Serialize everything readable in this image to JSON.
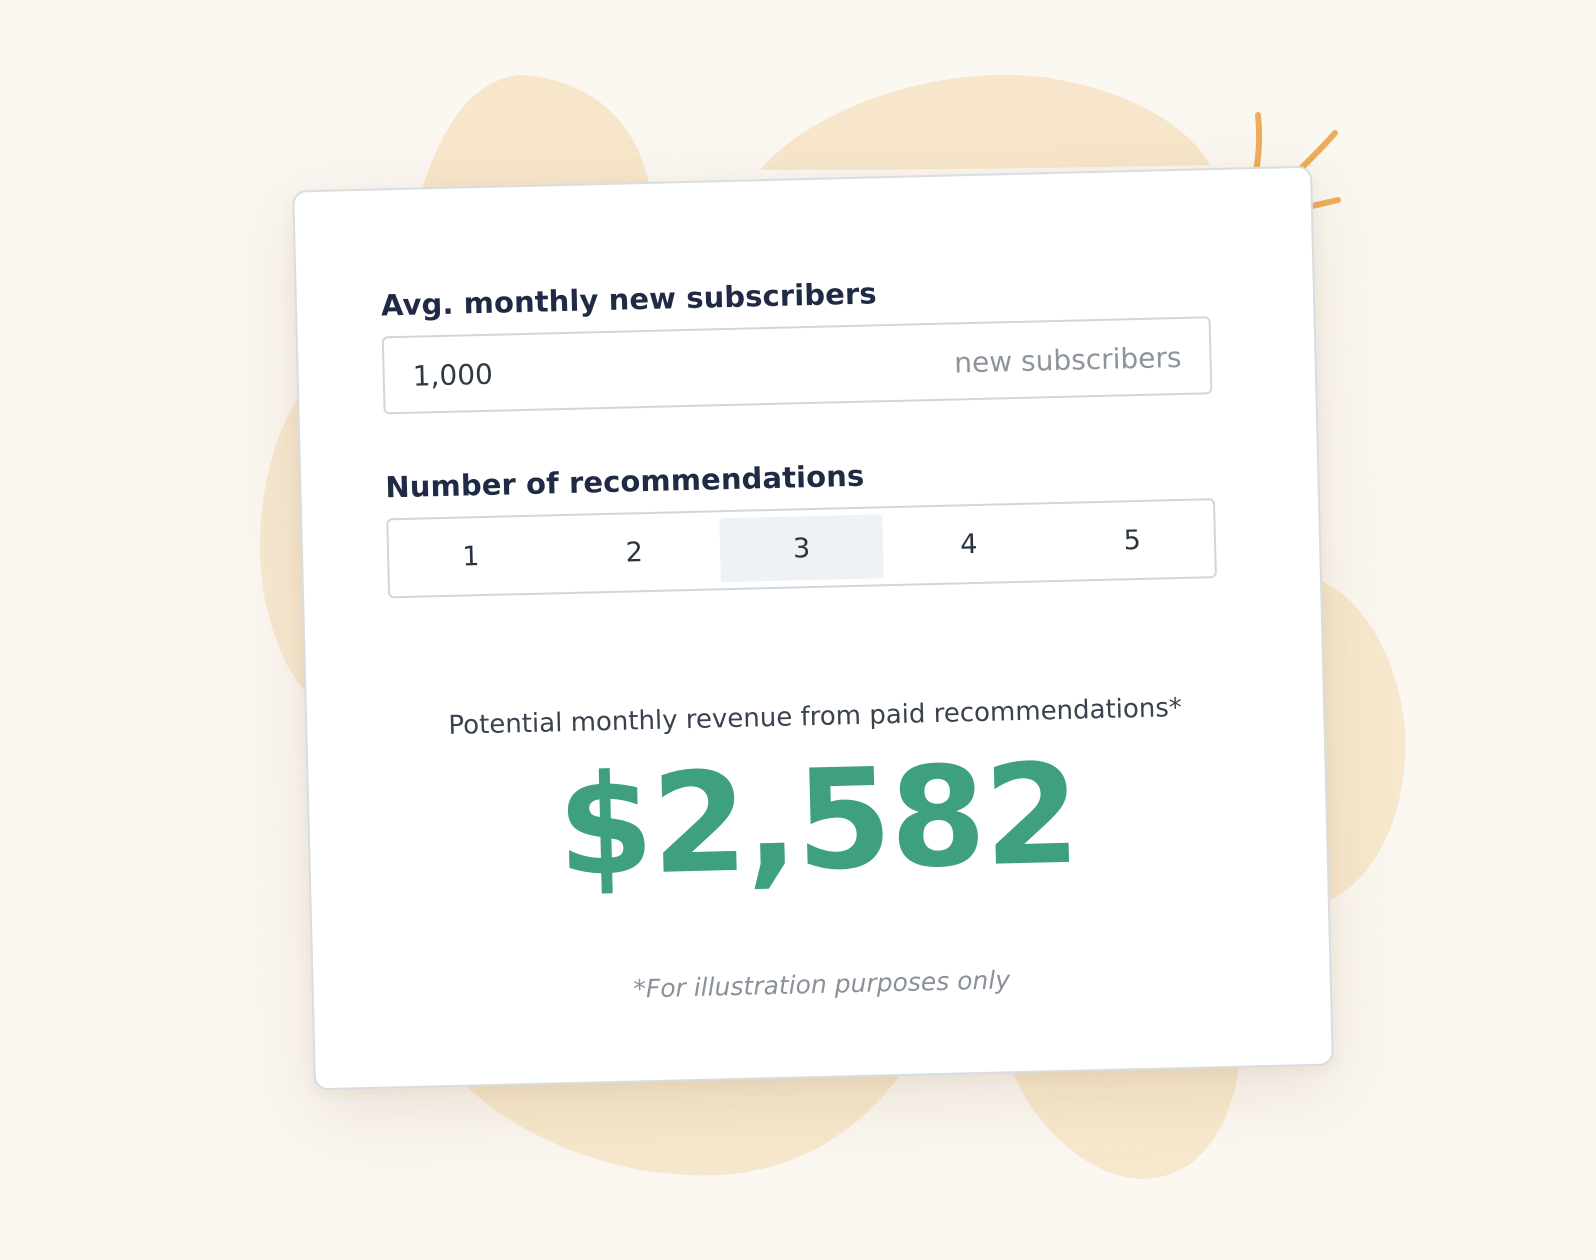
{
  "colors": {
    "background": "#fbf7f1",
    "blob": "#f6e3c4",
    "sparkle": "#ecae58",
    "label_text": "#1f2a44",
    "revenue_green": "#3fa07f",
    "active_segment": "#eef2f5"
  },
  "form": {
    "subscribers_label": "Avg. monthly new subscribers",
    "subscribers_value": "1,000",
    "subscribers_suffix": "new subscribers",
    "recommendations_label": "Number of recommendations",
    "recommendation_options": [
      "1",
      "2",
      "3",
      "4",
      "5"
    ],
    "selected_recommendation": "3"
  },
  "result": {
    "label": "Potential monthly revenue from paid recommendations*",
    "value": "$2,582"
  },
  "footnote": "*For illustration purposes only",
  "decorations": {
    "sparkle_icon": "sparkle-lines-icon",
    "background_shape": "watercolor-blob"
  }
}
